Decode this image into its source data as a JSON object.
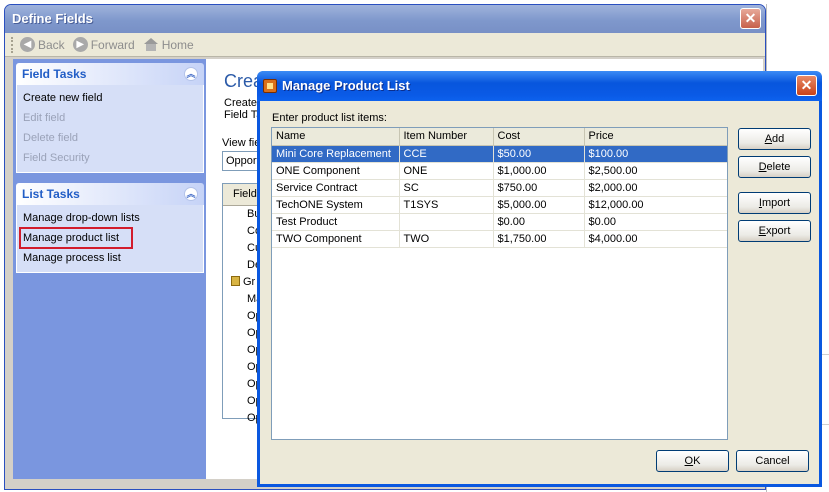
{
  "define_fields": {
    "title": "Define Fields",
    "close_glyph": "✕",
    "toolbar": {
      "back_label": "Back",
      "forward_label": "Forward",
      "home_label": "Home"
    },
    "field_tasks": {
      "header": "Field Tasks",
      "items": [
        "Create new field",
        "Edit field",
        "Delete field",
        "Field Security"
      ]
    },
    "list_tasks": {
      "header": "List Tasks",
      "items": [
        "Manage drop-down lists",
        "Manage product list",
        "Manage process list"
      ]
    },
    "main": {
      "heading": "Crea",
      "line1": "Create",
      "line2": "Field Ta",
      "view_label": "View fie",
      "select_value": "Opport",
      "list_header": "Field",
      "list_items": [
        "Bu",
        "Co",
        "Cu",
        "De",
        "Gr",
        "Ma",
        "Op",
        "Op",
        "Op",
        "Op",
        "Op",
        "Op",
        "Op"
      ]
    }
  },
  "dialog": {
    "title": "Manage Product List",
    "close_glyph": "✕",
    "prompt": "Enter product list items:",
    "columns": [
      "Name",
      "Item Number",
      "Cost",
      "Price"
    ],
    "rows": [
      [
        "Mini Core Replacement",
        "CCE",
        "$50.00",
        "$100.00"
      ],
      [
        "ONE Component",
        "ONE",
        "$1,000.00",
        "$2,500.00"
      ],
      [
        "Service Contract",
        "SC",
        "$750.00",
        "$2,000.00"
      ],
      [
        "TechONE System",
        "T1SYS",
        "$5,000.00",
        "$12,000.00"
      ],
      [
        "Test Product",
        "",
        "$0.00",
        "$0.00"
      ],
      [
        "TWO Component",
        "TWO",
        "$1,750.00",
        "$4,000.00"
      ]
    ],
    "buttons": {
      "add": {
        "mnemonic": "A",
        "rest": "dd"
      },
      "delete": {
        "mnemonic": "D",
        "rest": "elete"
      },
      "import": {
        "mnemonic": "I",
        "rest": "mport"
      },
      "export": {
        "mnemonic": "E",
        "rest": "xport"
      },
      "ok": {
        "mnemonic": "O",
        "rest": "K"
      },
      "cancel": "Cancel"
    }
  },
  "colors": {
    "selection": "#316ac5",
    "highlight_box": "#d21c2c",
    "dialog_title": "#0a58e0"
  }
}
